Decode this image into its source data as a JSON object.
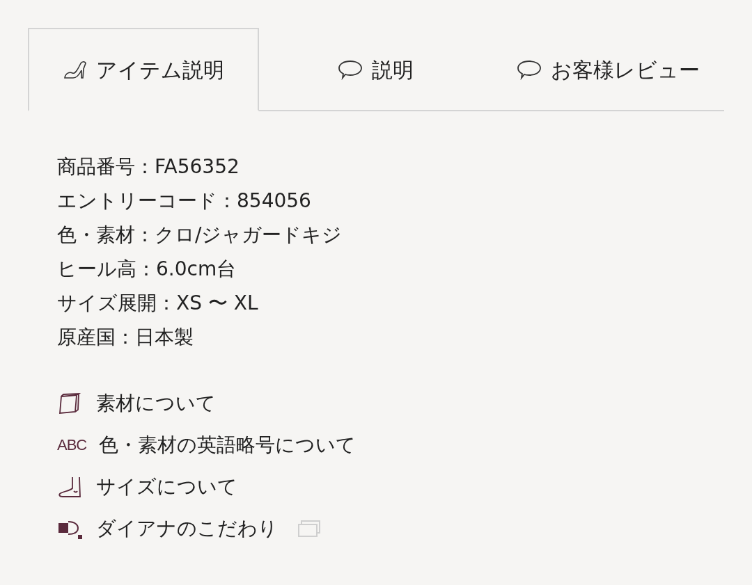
{
  "tabs": [
    {
      "label": "アイテム説明",
      "kind": "shoe",
      "selected": true
    },
    {
      "label": "説明",
      "kind": "speech",
      "selected": false
    },
    {
      "label": "お客様レビュー",
      "kind": "speech",
      "selected": false
    }
  ],
  "details": [
    "商品番号：FA56352",
    "エントリーコード：854056",
    "色・素材：クロ/ジャガードキジ",
    "ヒール高：6.0cm台",
    "サイズ展開：XS 〜 XL",
    "原産国：日本製"
  ],
  "links": [
    {
      "kind": "fabric",
      "label": "素材について",
      "external": false
    },
    {
      "kind": "letters",
      "icon_text": "ABC",
      "label": "色・素材の英語略号について",
      "external": false
    },
    {
      "kind": "foot",
      "label": "サイズについて",
      "external": false
    },
    {
      "kind": "brand",
      "label": "ダイアナのこだわり",
      "external": true
    }
  ]
}
